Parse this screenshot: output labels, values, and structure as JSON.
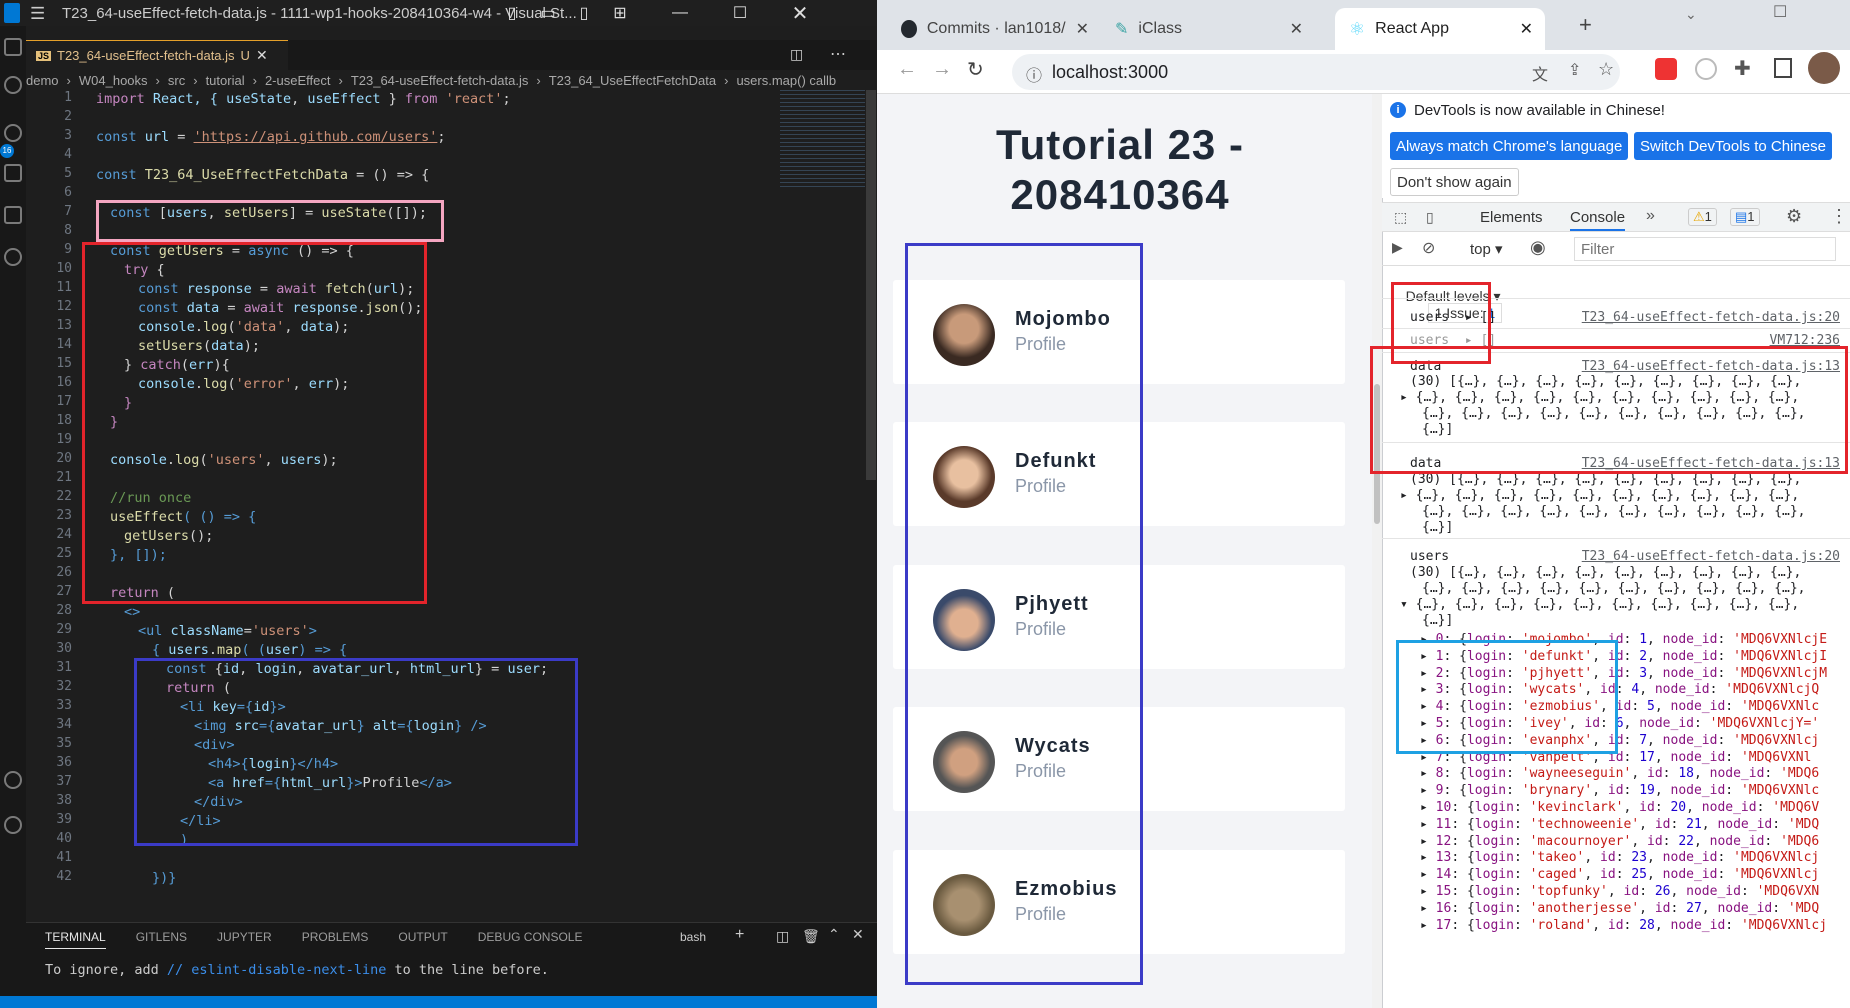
{
  "vscode": {
    "title": "T23_64-useEffect-fetch-data.js - 1111-wp1-hooks-208410364-w4 - Visual St...",
    "tab_label": "T23_64-useEffect-fetch-data.js",
    "tab_status": "U",
    "breadcrumb": [
      "demo",
      "W04_hooks",
      "src",
      "tutorial",
      "2-useEffect",
      "T23_64-useEffect-fetch-data.js",
      "T23_64_UseEffectFetchData",
      "users.map() callb"
    ],
    "activity_badge": "16",
    "line_numbers": [
      "1",
      "2",
      "3",
      "4",
      "5",
      "6",
      "7",
      "8",
      "9",
      "10",
      "11",
      "12",
      "13",
      "14",
      "15",
      "16",
      "17",
      "18",
      "19",
      "20",
      "21",
      "22",
      "23",
      "24",
      "25",
      "26",
      "27",
      "28",
      "29",
      "30",
      "31",
      "32",
      "33",
      "34",
      "35",
      "36",
      "37",
      "38",
      "39",
      "40",
      "41",
      "42"
    ],
    "code": {
      "l1_a": "import",
      "l1_b": " React, { ",
      "l1_c": "useState",
      "l1_d": ", ",
      "l1_e": "useEffect",
      "l1_f": " } ",
      "l1_g": "from",
      "l1_h": "'react'",
      "l1_i": ";",
      "l3_a": "const",
      "l3_b": " url",
      "l3_c": " = ",
      "l3_d": "'https://api.github.com/users'",
      "l3_e": ";",
      "l5_a": "const",
      "l5_b": " T23_64_UseEffectFetchData",
      "l5_c": " = () => {",
      "l7_a": "const",
      "l7_b": " [",
      "l7_c": "users",
      "l7_d": ", ",
      "l7_e": "setUsers",
      "l7_f": "] = ",
      "l7_g": "useState",
      "l7_h": "([]);",
      "l9_a": "const",
      "l9_b": " getUsers",
      "l9_c": " = ",
      "l9_d": "async",
      "l9_e": " () => {",
      "l10_a": "try",
      "l10_b": " {",
      "l11_a": "const",
      "l11_b": " response",
      "l11_c": " = ",
      "l11_d": "await",
      "l11_e": " fetch",
      "l11_f": "(",
      "l11_g": "url",
      "l11_h": ");",
      "l12_a": "const",
      "l12_b": " data",
      "l12_c": " = ",
      "l12_d": "await",
      "l12_e": " response",
      "l12_f": ".",
      "l12_g": "json",
      "l12_h": "();",
      "l13_a": "console",
      "l13_b": ".",
      "l13_c": "log",
      "l13_d": "(",
      "l13_e": "'data'",
      "l13_f": ", ",
      "l13_g": "data",
      "l13_h": ");",
      "l14_a": "setUsers",
      "l14_b": "(",
      "l14_c": "data",
      "l14_d": ");",
      "l15_a": "} ",
      "l15_b": "catch",
      "l15_c": "(",
      "l15_d": "err",
      "l15_e": "){",
      "l16_a": "console",
      "l16_b": ".",
      "l16_c": "log",
      "l16_d": "(",
      "l16_e": "'error'",
      "l16_f": ", ",
      "l16_g": "err",
      "l16_h": ");",
      "l17": "}",
      "l18": "}",
      "l20_a": "console",
      "l20_b": ".",
      "l20_c": "log",
      "l20_d": "(",
      "l20_e": "'users'",
      "l20_f": ", ",
      "l20_g": "users",
      "l20_h": ");",
      "l22": "//run once",
      "l23_a": "useEffect",
      "l23_b": "( () => {",
      "l24_a": "getUsers",
      "l24_b": "();",
      "l25": "}, []);",
      "l27_a": "return",
      "l27_b": " (",
      "l28": "<>",
      "l29_a": "<",
      "l29_b": "ul",
      "l29_c": " className",
      "l29_d": "=",
      "l29_e": "'users'",
      "l29_f": ">",
      "l30_a": "{ ",
      "l30_b": "users",
      "l30_c": ".",
      "l30_d": "map",
      "l30_e": "( (",
      "l30_f": "user",
      "l30_g": ") => {",
      "l31_a": "const",
      "l31_b": " {",
      "l31_c": "id",
      "l31_d": ", ",
      "l31_e": "login",
      "l31_f": ", ",
      "l31_g": "avatar_url",
      "l31_h": ", ",
      "l31_i": "html_url",
      "l31_j": "} = ",
      "l31_k": "user",
      "l31_l": ";",
      "l32_a": "return",
      "l32_b": " (",
      "l33_a": "<",
      "l33_b": "li",
      "l33_c": " key",
      "l33_d": "={",
      "l33_e": "id",
      "l33_f": "}>",
      "l34_a": "<",
      "l34_b": "img",
      "l34_c": " src",
      "l34_d": "={",
      "l34_e": "avatar_url",
      "l34_f": "} ",
      "l34_g": "alt",
      "l34_h": "={",
      "l34_i": "login",
      "l34_j": "} />",
      "l35_a": "<",
      "l35_b": "div",
      "l35_c": ">",
      "l36_a": "<",
      "l36_b": "h4",
      "l36_c": ">{",
      "l36_d": "login",
      "l36_e": "}</",
      "l36_f": "h4",
      "l36_g": ">",
      "l37_a": "<",
      "l37_b": "a",
      "l37_c": " href",
      "l37_d": "={",
      "l37_e": "html_url",
      "l37_f": "}>",
      "l37_g": "Profile",
      "l37_h": "</",
      "l37_i": "a",
      "l37_j": ">",
      "l38_a": "</",
      "l38_b": "div",
      "l38_c": ">",
      "l39_a": "</",
      "l39_b": "li",
      "l39_c": ">",
      "l40": ")",
      "l42": "})}"
    },
    "panel_tabs": [
      "TERMINAL",
      "GITLENS",
      "JUPYTER",
      "PROBLEMS",
      "OUTPUT",
      "DEBUG CONSOLE"
    ],
    "terminal_shell": "bash",
    "terminal_line_a": "To ignore, add ",
    "terminal_line_b": "// eslint-disable-next-line",
    "terminal_line_c": " to the line before."
  },
  "chrome": {
    "tabs": [
      "Commits · lan1018/",
      "iClass",
      "React App"
    ],
    "url": "localhost:3000"
  },
  "app": {
    "title_line1": "Tutorial 23 -",
    "title_line2": "208410364",
    "users": [
      {
        "login": "Mojombo",
        "link": "Profile"
      },
      {
        "login": "Defunkt",
        "link": "Profile"
      },
      {
        "login": "Pjhyett",
        "link": "Profile"
      },
      {
        "login": "Wycats",
        "link": "Profile"
      },
      {
        "login": "Ezmobius",
        "link": "Profile"
      }
    ]
  },
  "devtools": {
    "info": "DevTools is now available in Chinese!",
    "btn_match": "Always match Chrome's language",
    "btn_switch": "Switch DevTools to Chinese",
    "btn_dont": "Don't show again",
    "tab_elements": "Elements",
    "tab_console": "Console",
    "warn_count": "1",
    "msg_count": "1",
    "context": "top",
    "filter_placeholder": "Filter",
    "levels": "Default levels",
    "issues": "1 Issue:",
    "issues_count": "1",
    "log1_label": "users",
    "log1_value": "[]",
    "log1_src": "T23_64-useEffect-fetch-data.js:20",
    "log2_label": "users",
    "log2_value": "[]",
    "log2_src": "VM712:236",
    "log3_label": "data",
    "log3_src": "T23_64-useEffect-fetch-data.js:13",
    "log4_label": "data",
    "log4_src": "T23_64-useEffect-fetch-data.js:13",
    "log5_label": "users",
    "log5_src": "T23_64-useEffect-fetch-data.js:20",
    "arr_line1": "(30) [{…}, {…}, {…}, {…}, {…}, {…}, {…}, {…}, {…},",
    "arr_line2": "{…}, {…}, {…}, {…}, {…}, {…}, {…}, {…}, {…}, {…},",
    "arr_line3": "{…}, {…}, {…}, {…}, {…}, {…}, {…}, {…}, {…}, {…},",
    "arr_line4": "{…}]",
    "users_rows": [
      {
        "idx": "0",
        "login": "'mojombo'",
        "id": "1",
        "node": "'MDQ6VXNlcjE"
      },
      {
        "idx": "1",
        "login": "'defunkt'",
        "id": "2",
        "node": "'MDQ6VXNlcjI"
      },
      {
        "idx": "2",
        "login": "'pjhyett'",
        "id": "3",
        "node": "'MDQ6VXNlcjM"
      },
      {
        "idx": "3",
        "login": "'wycats'",
        "id": "4",
        "node": "'MDQ6VXNlcjQ"
      },
      {
        "idx": "4",
        "login": "'ezmobius'",
        "id": "5",
        "node": "'MDQ6VXNlc"
      },
      {
        "idx": "5",
        "login": "'ivey'",
        "id": "6",
        "node": "'MDQ6VXNlcjY='"
      },
      {
        "idx": "6",
        "login": "'evanphx'",
        "id": "7",
        "node": "'MDQ6VXNlcj"
      },
      {
        "idx": "7",
        "login": "'vanpelt'",
        "id": "17",
        "node": "'MDQ6VXNl"
      },
      {
        "idx": "8",
        "login": "'wayneeseguin'",
        "id": "18",
        "node": "'MDQ6"
      },
      {
        "idx": "9",
        "login": "'brynary'",
        "id": "19",
        "node": "'MDQ6VXNlc"
      },
      {
        "idx": "10",
        "login": "'kevinclark'",
        "id": "20",
        "node": "'MDQ6V"
      },
      {
        "idx": "11",
        "login": "'technoweenie'",
        "id": "21",
        "node": "'MDQ"
      },
      {
        "idx": "12",
        "login": "'macournoyer'",
        "id": "22",
        "node": "'MDQ6"
      },
      {
        "idx": "13",
        "login": "'takeo'",
        "id": "23",
        "node": "'MDQ6VXNlcj"
      },
      {
        "idx": "14",
        "login": "'caged'",
        "id": "25",
        "node": "'MDQ6VXNlcj"
      },
      {
        "idx": "15",
        "login": "'topfunky'",
        "id": "26",
        "node": "'MDQ6VXN"
      },
      {
        "idx": "16",
        "login": "'anotherjesse'",
        "id": "27",
        "node": "'MDQ"
      },
      {
        "idx": "17",
        "login": "'roland'",
        "id": "28",
        "node": "'MDQ6VXNlcj"
      }
    ]
  },
  "colors": {
    "pink_box": "#f4a6c1",
    "red_box": "#e3242b",
    "blue_box": "#3b3bc7",
    "cyan_box": "#1ea1e3",
    "vs_status": "#0078d4"
  }
}
